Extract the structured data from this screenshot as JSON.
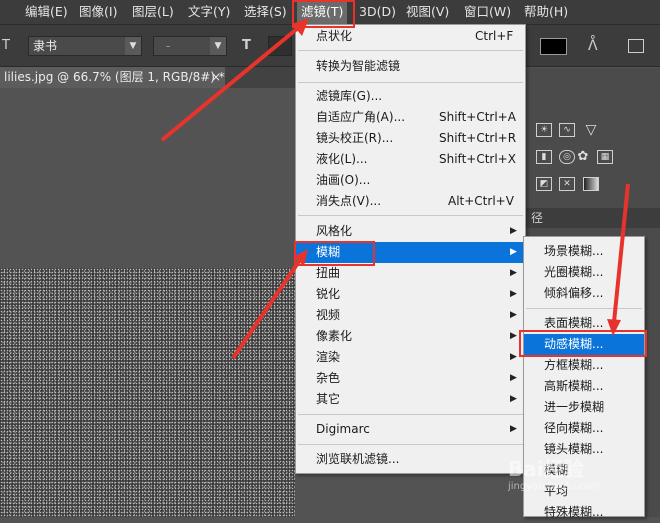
{
  "menubar": {
    "items": [
      {
        "label": "编辑(E)"
      },
      {
        "label": "图像(I)"
      },
      {
        "label": "图层(L)"
      },
      {
        "label": "文字(Y)"
      },
      {
        "label": "选择(S)"
      },
      {
        "label": "滤镜(T)"
      },
      {
        "label": "3D(D)"
      },
      {
        "label": "视图(V)"
      },
      {
        "label": "窗口(W)"
      },
      {
        "label": "帮助(H)"
      }
    ]
  },
  "toolbar": {
    "font_family": "隶书",
    "font_style": "-",
    "color_swatch": "#000000"
  },
  "document_tab": {
    "title": "lilies.jpg @ 66.7% (图层 1, RGB/8#) *",
    "close": "×"
  },
  "panel": {
    "tab_partial": "径"
  },
  "filter_menu": {
    "items": [
      {
        "label": "点状化",
        "shortcut": "Ctrl+F"
      },
      {
        "label": "转换为智能滤镜",
        "shortcut": ""
      },
      {
        "label": "滤镜库(G)...",
        "shortcut": ""
      },
      {
        "label": "自适应广角(A)...",
        "shortcut": "Shift+Ctrl+A"
      },
      {
        "label": "镜头校正(R)...",
        "shortcut": "Shift+Ctrl+R"
      },
      {
        "label": "液化(L)...",
        "shortcut": "Shift+Ctrl+X"
      },
      {
        "label": "油画(O)...",
        "shortcut": ""
      },
      {
        "label": "消失点(V)...",
        "shortcut": "Alt+Ctrl+V"
      },
      {
        "label": "风格化",
        "shortcut": ""
      },
      {
        "label": "模糊",
        "shortcut": ""
      },
      {
        "label": "扭曲",
        "shortcut": ""
      },
      {
        "label": "锐化",
        "shortcut": ""
      },
      {
        "label": "视频",
        "shortcut": ""
      },
      {
        "label": "像素化",
        "shortcut": ""
      },
      {
        "label": "渲染",
        "shortcut": ""
      },
      {
        "label": "杂色",
        "shortcut": ""
      },
      {
        "label": "其它",
        "shortcut": ""
      },
      {
        "label": "Digimarc",
        "shortcut": ""
      },
      {
        "label": "浏览联机滤镜...",
        "shortcut": ""
      }
    ]
  },
  "blur_submenu": {
    "items": [
      {
        "label": "场景模糊..."
      },
      {
        "label": "光圈模糊..."
      },
      {
        "label": "倾斜偏移..."
      },
      {
        "label": "表面模糊..."
      },
      {
        "label": "动感模糊..."
      },
      {
        "label": "方框模糊..."
      },
      {
        "label": "高斯模糊..."
      },
      {
        "label": "进一步模糊"
      },
      {
        "label": "径向模糊..."
      },
      {
        "label": "镜头模糊..."
      },
      {
        "label": "模糊"
      },
      {
        "label": "平均"
      },
      {
        "label": "特殊模糊..."
      }
    ]
  },
  "watermark": {
    "logo_text": "Bai经验",
    "url_text": "jingyan.baidu.com"
  },
  "colors": {
    "highlight": "#0a74da",
    "annotation_red": "#e8332c"
  }
}
